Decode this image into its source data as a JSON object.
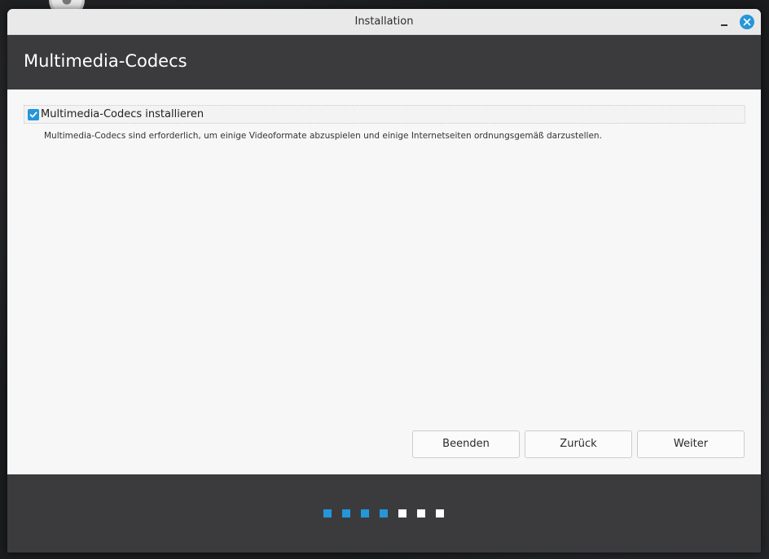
{
  "window": {
    "title": "Installation"
  },
  "header": {
    "title": "Multimedia-Codecs"
  },
  "content": {
    "checkbox": {
      "label": "Multimedia-Codecs installieren",
      "checked": true
    },
    "description": "Multimedia-Codecs sind erforderlich, um einige Videoformate abzuspielen und einige Internetseiten ordnungsgemäß darzustellen."
  },
  "buttons": {
    "quit": "Beenden",
    "back": "Zurück",
    "next": "Weiter"
  },
  "progress": {
    "completed_steps": 4,
    "total_steps": 7
  },
  "colors": {
    "accent": "#2596d8",
    "header_bg": "#3b3b3d",
    "content_bg": "#f7f7f7"
  }
}
